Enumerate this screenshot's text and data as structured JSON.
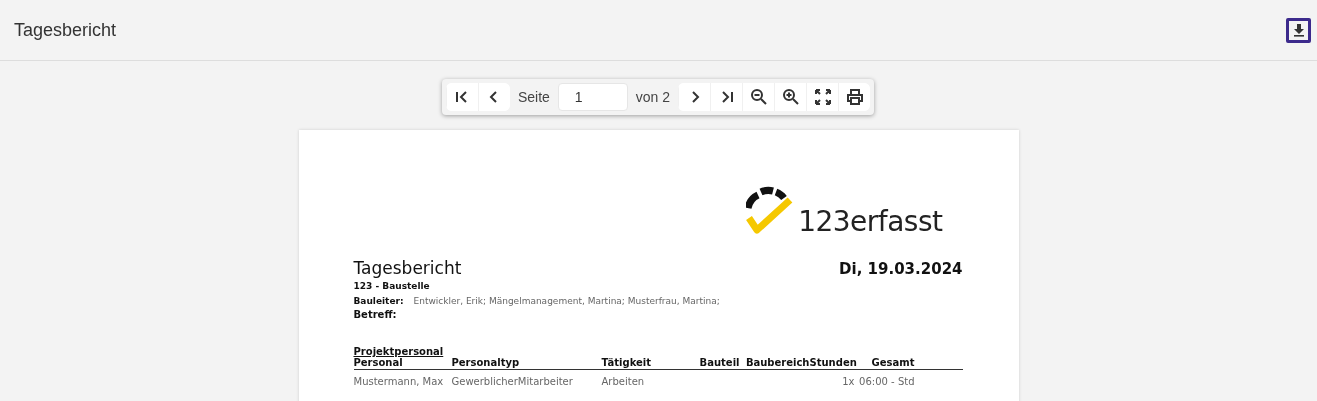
{
  "header": {
    "title": "Tagesbericht"
  },
  "toolbar": {
    "page_label": "Seite",
    "page_value": "1",
    "page_total": "von 2"
  },
  "report": {
    "logo_text": "123erfasst",
    "title": "Tagesbericht",
    "date": "Di, 19.03.2024",
    "site": "123 - Baustelle",
    "manager_label": "Bauleiter:",
    "managers": "Entwickler, Erik; Mängelmanagement, Martina; Musterfrau, Martina;",
    "subject_label": "Betreff:",
    "section": "Projektpersonal",
    "columns": [
      "Personal",
      "Personaltyp",
      "Tätigkeit",
      "Bauteil",
      "Baubereich",
      "Stunden",
      "Gesamt"
    ],
    "rows": [
      [
        "Mustermann, Max",
        "GewerblicherMitarbeiter",
        "Arbeiten",
        "",
        "",
        "1x",
        "06:00 - Std"
      ]
    ]
  }
}
